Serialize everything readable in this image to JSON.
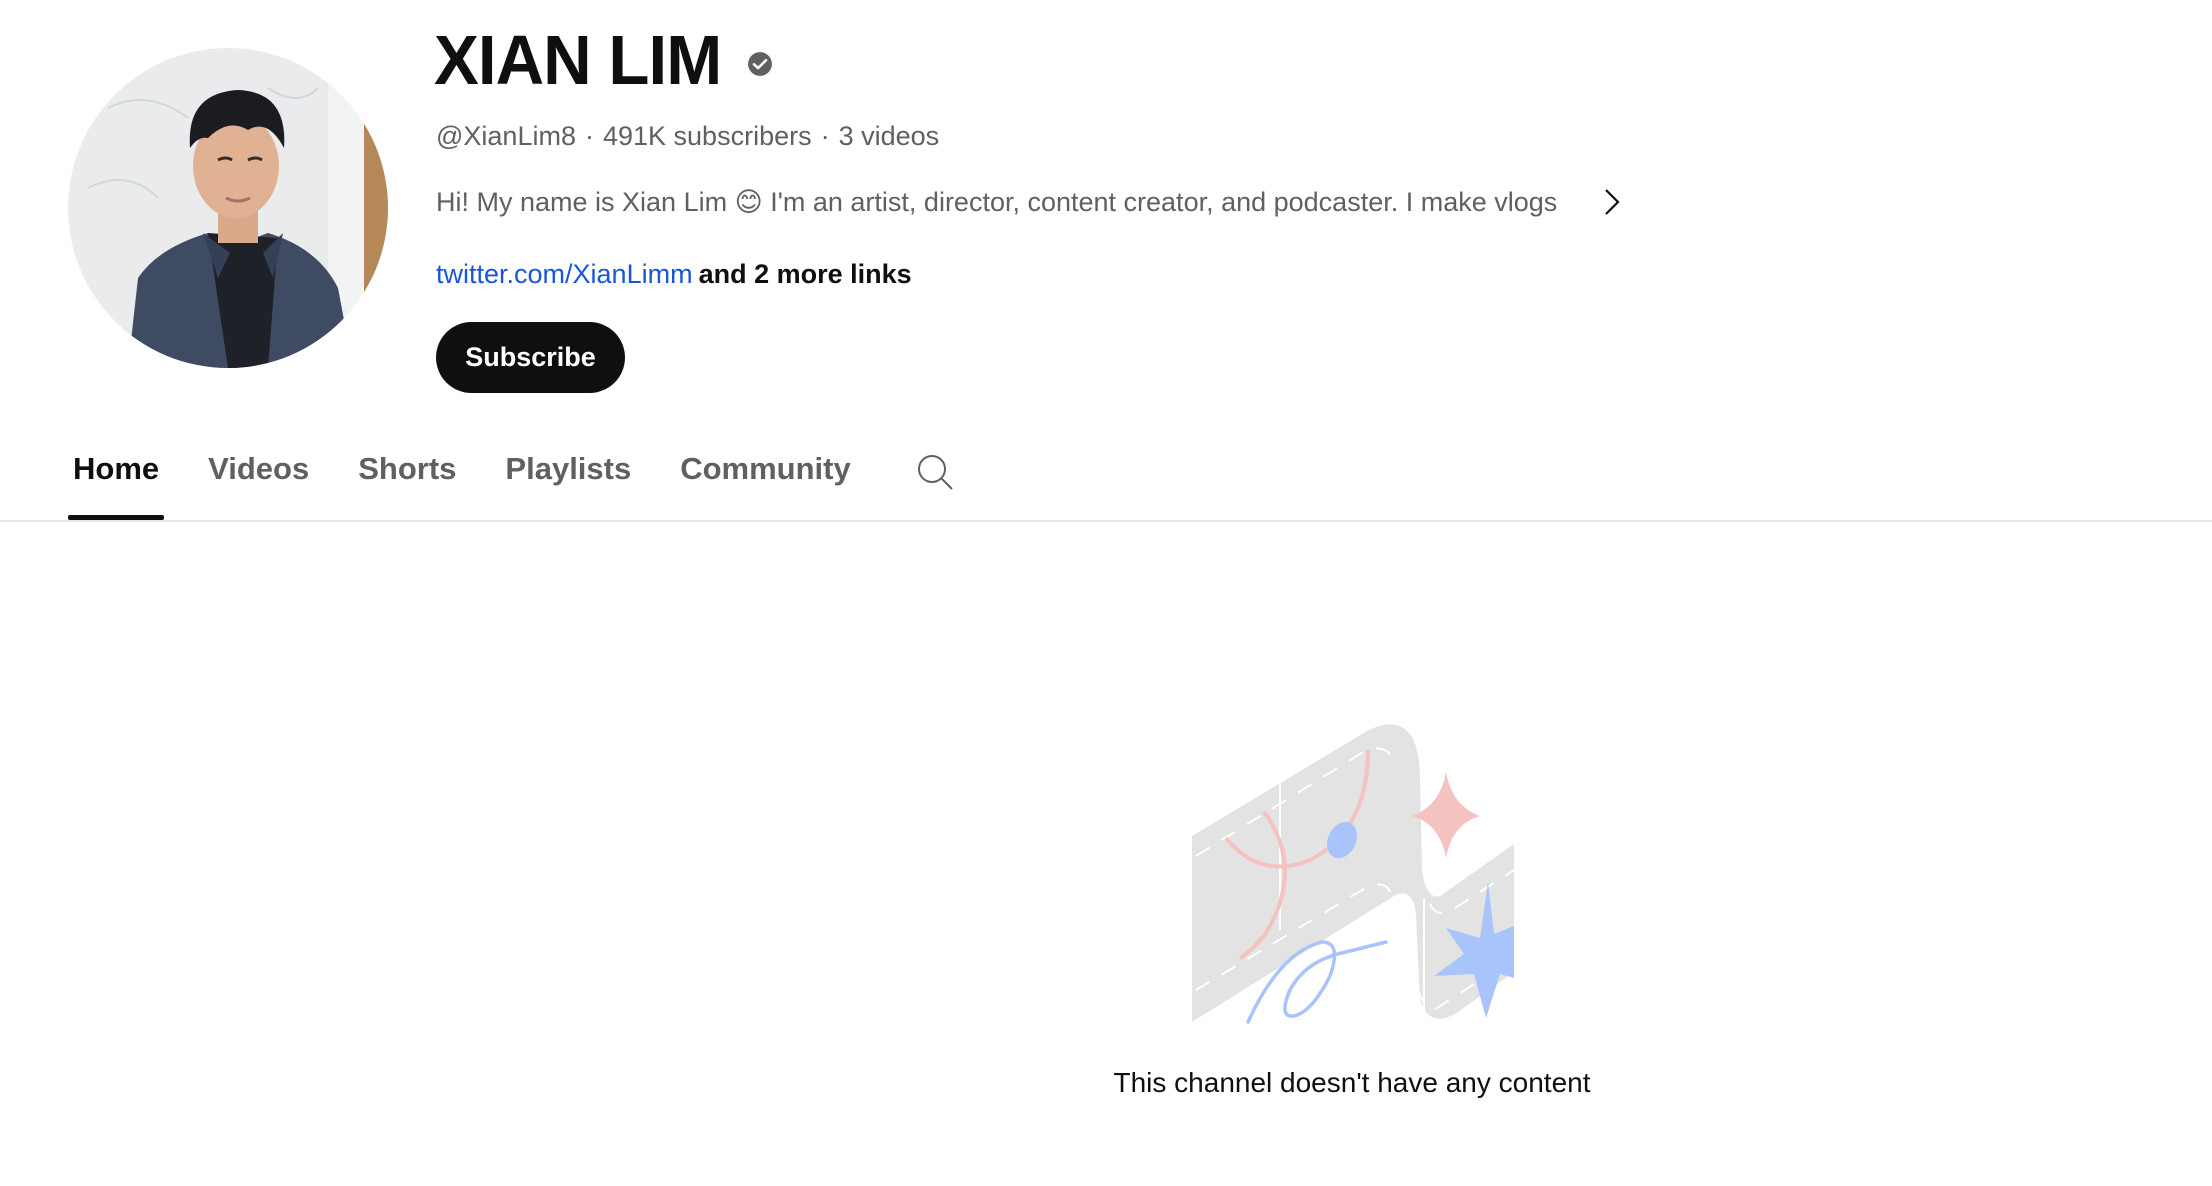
{
  "channel": {
    "name": "XIAN LIM",
    "verified": true,
    "handle": "@XianLim8",
    "separator": "·",
    "subscribers": "491K subscribers",
    "videos": "3 videos",
    "description": "Hi! My name is Xian Lim 😊 I'm an artist, director, content creator, and podcaster. I make vlogs",
    "link": "twitter.com/XianLimm",
    "more_links": "and 2 more links",
    "subscribe_label": "Subscribe"
  },
  "icons": {
    "verified": "verified-check-icon",
    "chevron": "chevron-right-icon",
    "search": "search-icon"
  },
  "tabs": [
    {
      "label": "Home",
      "active": true
    },
    {
      "label": "Videos",
      "active": false
    },
    {
      "label": "Shorts",
      "active": false
    },
    {
      "label": "Playlists",
      "active": false
    },
    {
      "label": "Community",
      "active": false
    }
  ],
  "empty_state": {
    "message": "This channel doesn't have any content"
  },
  "colors": {
    "primary_text": "#0f0f0f",
    "secondary_text": "#606060",
    "link": "#1a56d6",
    "divider": "#e5e5e5",
    "illustration_gray": "#e3e3e3",
    "illustration_pink": "#f4c2bf",
    "illustration_blue": "#a8c4fa"
  }
}
